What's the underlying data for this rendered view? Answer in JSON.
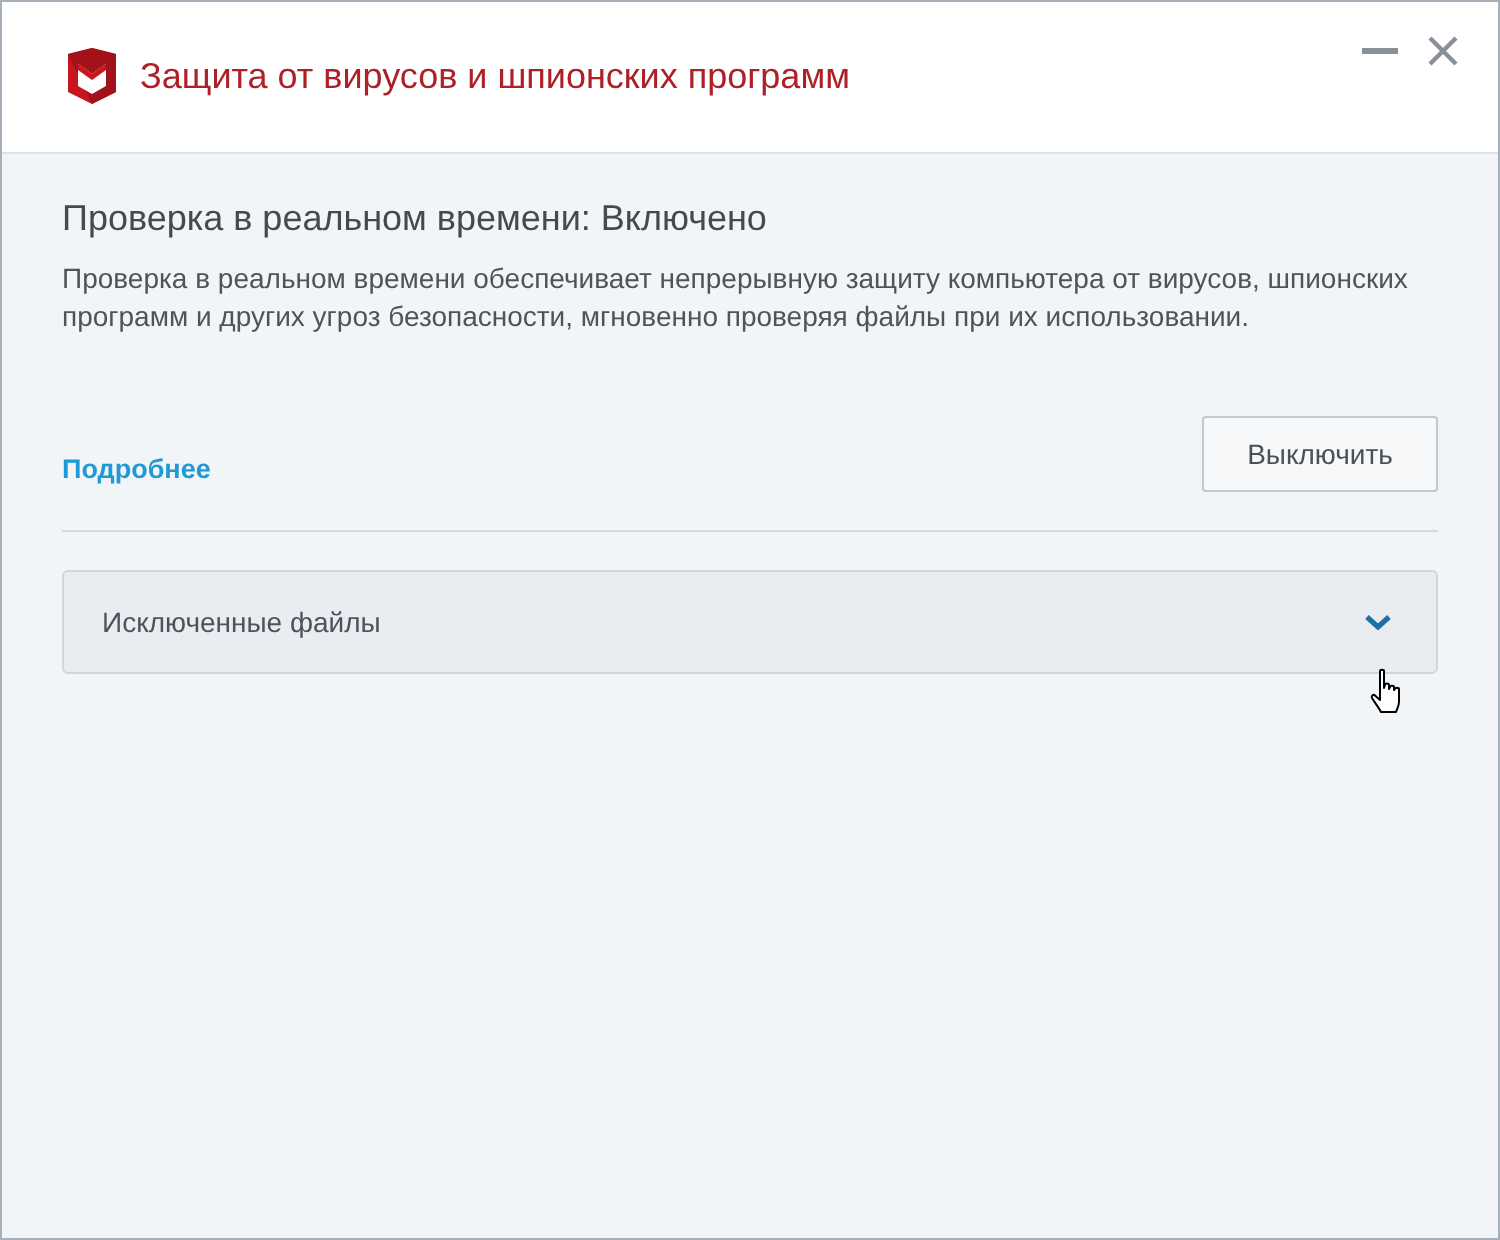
{
  "window": {
    "title": "Защита от вирусов и шпионских программ"
  },
  "status": {
    "heading": "Проверка в реальном времени: Включено",
    "description": "Проверка в реальном времени обеспечивает непрерывную защиту компьютера от вирусов, шпионских программ и других угроз безопасности, мгновенно проверяя файлы при их использовании."
  },
  "more_link": "Подробнее",
  "toggle_button": "Выключить",
  "sections": [
    {
      "label": "Исключенные файлы",
      "expanded": false
    }
  ]
}
